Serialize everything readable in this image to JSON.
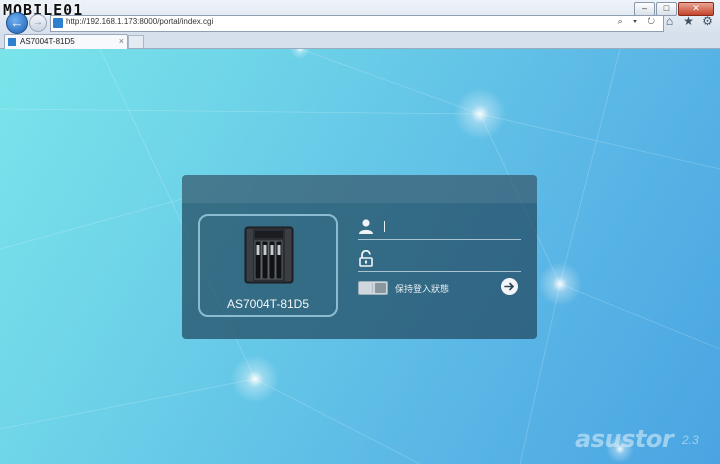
{
  "watermark": {
    "text": "MOBILE01"
  },
  "browser": {
    "url": "http://192.168.1.173:8000/portal/index.cgi",
    "address_icons": "⌕ ▾ ↻",
    "tab": {
      "title": "AS7004T-81D5",
      "close_glyph": "×"
    },
    "window_controls": {
      "minimize": "–",
      "maximize": "□",
      "close": "✕"
    },
    "nav": {
      "back": "←",
      "forward": "→"
    },
    "toolbar": {
      "home": "⌂",
      "favorites": "★",
      "settings": "⚙"
    }
  },
  "login": {
    "device_name": "AS7004T-81D5",
    "username_value": "",
    "password_value": "",
    "remember_label": "保持登入狀態",
    "remember_checked": false
  },
  "branding": {
    "logo": "asustor",
    "version": "2.3"
  }
}
